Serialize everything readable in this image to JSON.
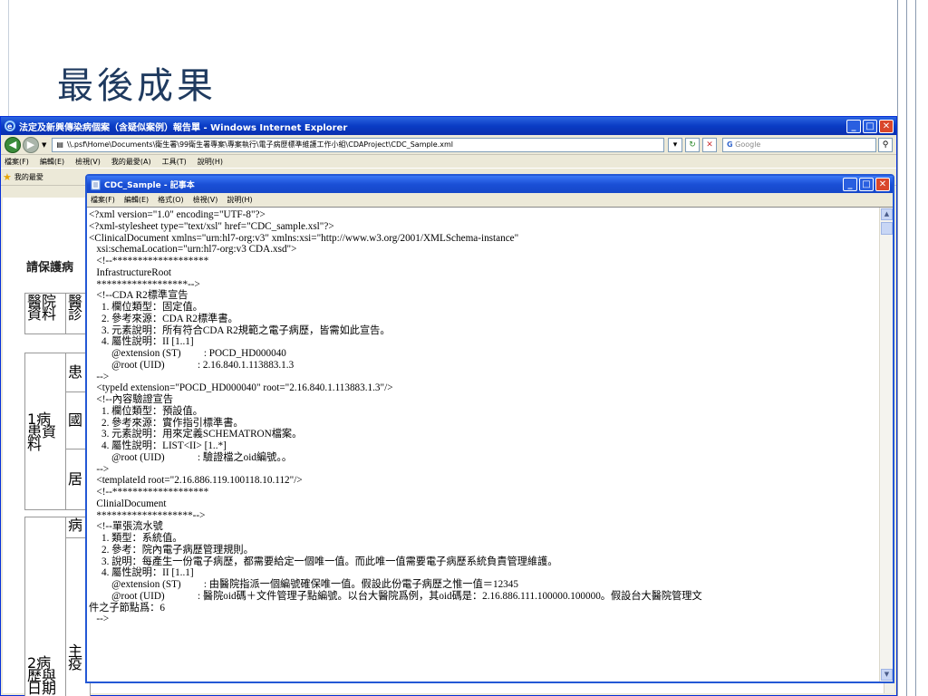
{
  "slide": {
    "title": "最後成果"
  },
  "ie": {
    "title": "法定及新興傳染病個案（含疑似案例）報告單 - Windows Internet Explorer",
    "address": "\\\\.psf\\Home\\Documents\\衛生署\\99衛生署專案\\專案執行\\電子病歷標準維護工作小組\\CDAProject\\CDC_Sample.xml",
    "search_placeholder": "Google",
    "menu": [
      "檔案(F)",
      "編輯(E)",
      "檢視(V)",
      "我的最愛(A)",
      "工具(T)",
      "說明(H)"
    ],
    "favorites_label": "我的最愛"
  },
  "background_page": {
    "heading": "請保護病",
    "cells": [
      "醫院資料",
      "醫",
      "診",
      "患",
      "1病患資料",
      "國",
      "居",
      "病",
      "主疫",
      "2病歷與日期"
    ]
  },
  "notepad": {
    "title": "CDC_Sample - 記事本",
    "menu": [
      "檔案(F)",
      "編輯(E)",
      "格式(O)",
      "檢視(V)",
      "說明(H)"
    ],
    "lines": [
      "<?xml version=\"1.0\" encoding=\"UTF-8\"?>",
      "<?xml-stylesheet type=\"text/xsl\" href=\"CDC_sample.xsl\"?>",
      "<ClinicalDocument xmlns=\"urn:hl7-org:v3\" xmlns:xsi=\"http://www.w3.org/2001/XMLSchema-instance\"",
      "   xsi:schemaLocation=\"urn:hl7-org:v3 CDA.xsd\">",
      "   <!--*******************",
      "   InfrastructureRoot",
      "   ******************-->",
      "   <!--CDA R2標準宣告",
      "     1. 欄位類型：固定值。",
      "     2. 參考來源：CDA R2標準書。",
      "     3. 元素說明：所有符合CDA R2規範之電子病歷，皆需如此宣告。",
      "     4. 屬性說明：II [1..1]",
      "         @extension (ST)         : POCD_HD000040",
      "         @root (UID)             : 2.16.840.1.113883.1.3",
      "   -->",
      "   <typeId extension=\"POCD_HD000040\" root=\"2.16.840.1.113883.1.3\"/>",
      "   <!--內容驗證宣告",
      "     1. 欄位類型：預設值。",
      "     2. 參考來源：實作指引標準書。",
      "     3. 元素說明：用來定義SCHEMATRON檔案。",
      "     4. 屬性說明：LIST<II> [1..*]",
      "         @root (UID)             : 驗證檔之oid編號。。",
      "   -->",
      "   <templateId root=\"2.16.886.119.100118.10.112\"/>",
      "   <!--*******************",
      "   ClinialDocument",
      "   *******************-->",
      "   <!--單張流水號",
      "     1. 類型：系統值。",
      "     2. 參考：院內電子病歷管理規則。",
      "     3. 說明：每產生一份電子病歷，都需要給定一個唯一值。而此唯一值需要電子病歷系統負責管理維護。",
      "     4. 屬性說明：II [1..1]",
      "         @extension (ST)         : 由醫院指派一個編號確保唯一值。假設此份電子病歷之惟一值＝12345",
      "         @root (UID)             : 醫院oid碼＋文件管理子點編號。以台大醫院爲例，其oid碼是：2.16.886.111.100000.100000。假設台大醫院管理文",
      "件之子節點爲：6",
      "   -->"
    ]
  }
}
